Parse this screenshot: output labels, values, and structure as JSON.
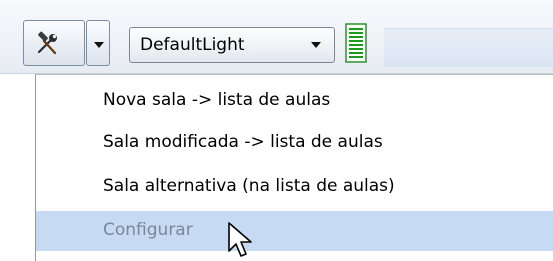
{
  "toolbar": {
    "tool_button_icon": "hammer-wrench-icon",
    "split_arrow_icon": "chevron-down-icon",
    "theme_select": {
      "value": "DefaultLight",
      "arrow_icon": "chevron-down-icon"
    },
    "sheet_icon": "document-lines-icon"
  },
  "menu": {
    "items": [
      {
        "label": "Nova sala -> lista de aulas",
        "state": "normal"
      },
      {
        "label": "Sala modificada -> lista de aulas",
        "state": "normal"
      },
      {
        "label": "Sala alternativa (na lista de aulas)",
        "state": "normal"
      },
      {
        "label": "Configurar",
        "state": "hover-disabled"
      }
    ]
  },
  "colors": {
    "menu_highlight": "#c7daf3",
    "disabled_text": "#7b8796",
    "toolbar_top": "#f7f9fc",
    "toolbar_bottom": "#e6ebf2"
  },
  "cursor_icon": "arrow-cursor-icon"
}
